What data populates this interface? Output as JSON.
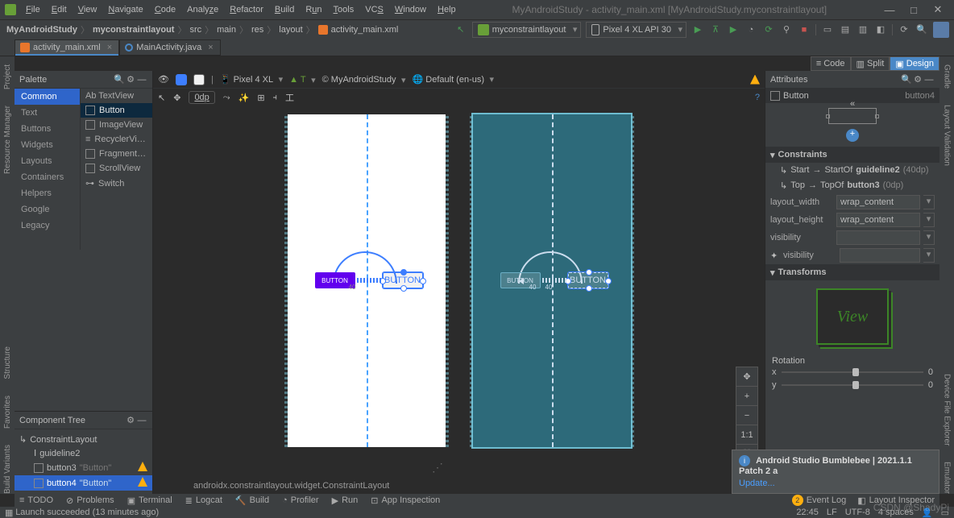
{
  "menu": {
    "items": [
      "File",
      "Edit",
      "View",
      "Navigate",
      "Code",
      "Analyze",
      "Refactor",
      "Build",
      "Run",
      "Tools",
      "VCS",
      "Window",
      "Help"
    ]
  },
  "window_title": "MyAndroidStudy - activity_main.xml [MyAndroidStudy.myconstraintlayout]",
  "breadcrumb": [
    "MyAndroidStudy",
    "myconstraintlayout",
    "src",
    "main",
    "res",
    "layout",
    "activity_main.xml"
  ],
  "run_config": "myconstraintlayout",
  "device_target": "Pixel 4 XL API 30",
  "tabs": [
    {
      "label": "activity_main.xml",
      "active": true,
      "type": "xml"
    },
    {
      "label": "MainActivity.java",
      "active": false,
      "type": "java"
    }
  ],
  "viewmodes": {
    "code": "Code",
    "split": "Split",
    "design": "Design",
    "active": "Design"
  },
  "palette": {
    "title": "Palette",
    "categories": [
      "Common",
      "Text",
      "Buttons",
      "Widgets",
      "Layouts",
      "Containers",
      "Helpers",
      "Google",
      "Legacy"
    ],
    "selected_cat": "Common",
    "items": [
      "Ab TextView",
      "Button",
      "ImageView",
      "RecyclerVi…",
      "Fragment…",
      "ScrollView",
      "Switch"
    ],
    "selected_item": "Button"
  },
  "ctree": {
    "title": "Component Tree",
    "root": "ConstraintLayout",
    "children": [
      {
        "name": "guideline2",
        "kind": "guide",
        "warn": false
      },
      {
        "name": "button3",
        "kind": "btn",
        "hint": "\"Button\"",
        "warn": true
      },
      {
        "name": "button4",
        "kind": "btn",
        "hint": "\"Button\"",
        "warn": true,
        "sel": true
      }
    ]
  },
  "design_toolbar": {
    "device": "Pixel 4 XL",
    "orient": "",
    "theme": "MyAndroidStudy",
    "locale": "Default (en-us)",
    "api": "T",
    "margin": "0dp"
  },
  "canvas": {
    "button_label": "BUTTON",
    "margin_a": "40",
    "margin_b": "40"
  },
  "zoom": {
    "pan": "✥",
    "plus": "+",
    "minus": "−",
    "fit": "1:1"
  },
  "breadpath": "androidx.constraintlayout.widget.ConstraintLayout",
  "attrs": {
    "title": "Attributes",
    "sel_type": "Button",
    "sel_id": "button4",
    "sections": {
      "constraints": "Constraints",
      "transforms": "Transforms"
    },
    "constraints": [
      {
        "side": "Start",
        "dir": "StartOf",
        "target": "guideline2",
        "margin": "(40dp)"
      },
      {
        "side": "Top",
        "dir": "TopOf",
        "target": "button3",
        "margin": "(0dp)"
      }
    ],
    "props": {
      "layout_width": {
        "label": "layout_width",
        "value": "wrap_content"
      },
      "layout_height": {
        "label": "layout_height",
        "value": "wrap_content"
      },
      "visibility": {
        "label": "visibility",
        "value": ""
      },
      "visibility2": {
        "label": "visibility",
        "value": ""
      }
    },
    "view_graphic": "View",
    "rotation": {
      "title": "Rotation",
      "x_label": "x",
      "y_label": "y",
      "x_val": "0",
      "y_val": "0"
    }
  },
  "notification": {
    "title": "Android Studio Bumblebee | 2021.1.1 Patch 2 a",
    "link": "Update..."
  },
  "btmbar": {
    "todo": "TODO",
    "problems": "Problems",
    "terminal": "Terminal",
    "logcat": "Logcat",
    "build": "Build",
    "profiler": "Profiler",
    "run": "Run",
    "appinsp": "App Inspection",
    "eventlog": "Event Log",
    "eventcount": "2",
    "layoutinsp": "Layout Inspector"
  },
  "status": {
    "msg": "Launch succeeded (13 minutes ago)",
    "pos": "22:45",
    "lf": "LF",
    "enc": "UTF-8",
    "indent": "4 spaces",
    "watermark": "CSDN @ShadyPi"
  },
  "sidepanels": {
    "left": [
      "Project",
      "Resource Manager",
      "Structure",
      "Favorites",
      "Build Variants"
    ],
    "right": [
      "Gradle",
      "Layout Validation",
      "Device File Explorer",
      "Emulator"
    ]
  }
}
